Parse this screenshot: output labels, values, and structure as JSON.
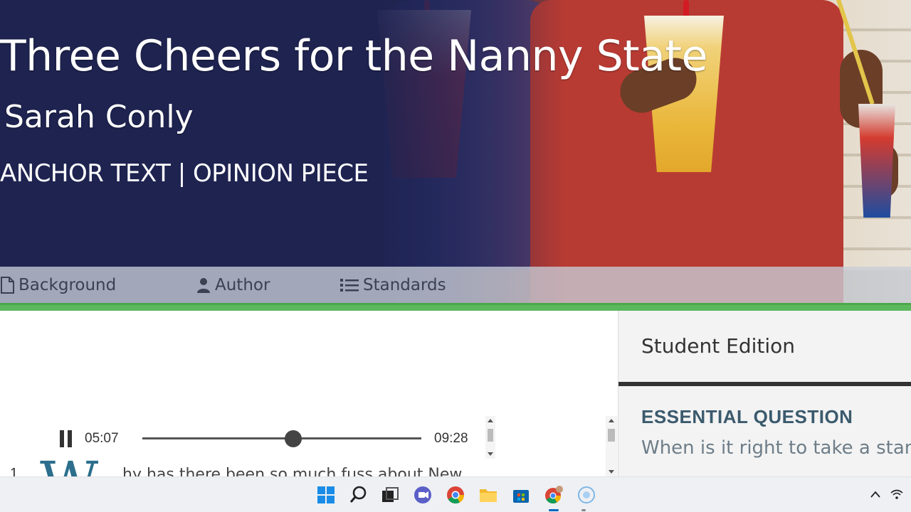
{
  "hero": {
    "title": "Three Cheers for the Nanny State",
    "author": "Sarah Conly",
    "text_type": "ANCHOR TEXT | OPINION PIECE"
  },
  "tabs": [
    {
      "label": "Background",
      "icon": "document-icon"
    },
    {
      "label": "Author",
      "icon": "person-icon"
    },
    {
      "label": "Standards",
      "icon": "list-icon"
    }
  ],
  "player": {
    "current_time": "05:07",
    "duration": "09:28",
    "progress": 0.54,
    "state": "playing"
  },
  "article": {
    "paragraph_number": "1",
    "drop_cap": "W",
    "first_line": "hy has there been so much fuss about New"
  },
  "side_panel": {
    "edition": "Student Edition",
    "essential_question_title": "ESSENTIAL QUESTION",
    "essential_question_text": "When is it right to take a stand"
  },
  "taskbar": {
    "apps": [
      "windows-start-icon",
      "search-icon",
      "task-view-icon",
      "teams-icon",
      "chrome-icon",
      "file-explorer-icon",
      "microsoft-store-icon",
      "chrome-profile-icon",
      "cortana-icon"
    ],
    "accent": "#0067c0"
  },
  "colors": {
    "hero_navy": "#1e2350",
    "green_rule": "#5cb85c",
    "eq_title": "#3b5a6d"
  }
}
